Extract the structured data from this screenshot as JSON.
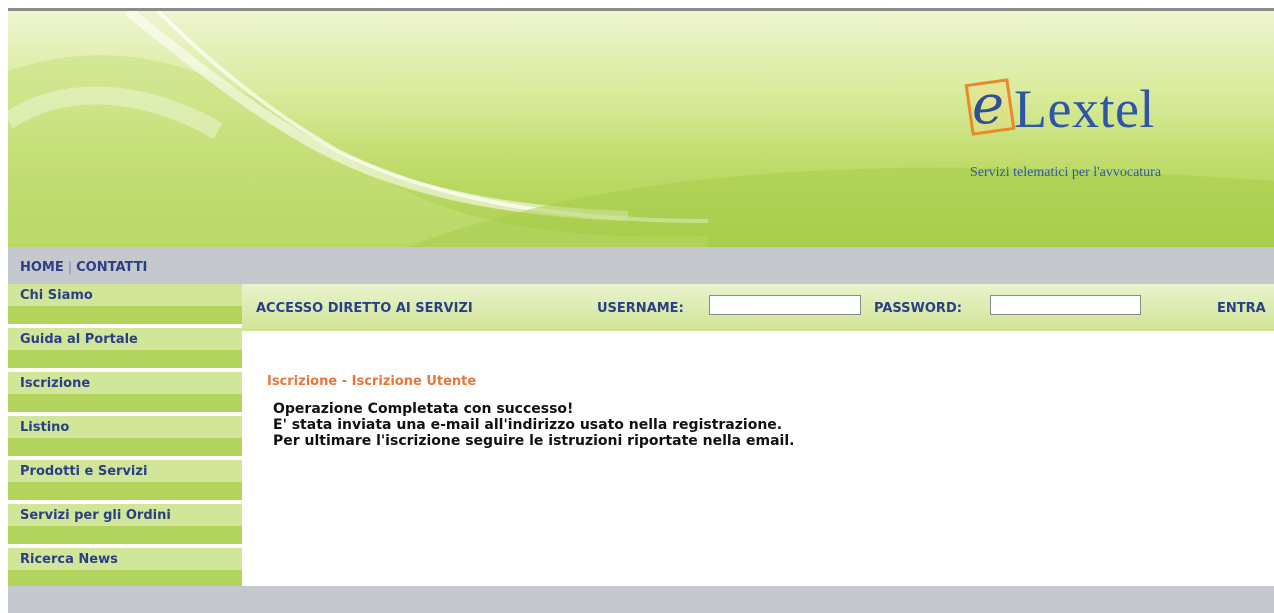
{
  "header": {
    "brand_name": "Lextel",
    "brand_initial": "e",
    "tagline": "Servizi telematici per l'avvocatura",
    "colors": {
      "banner_green": "#bfdc6a",
      "logo_blue": "#2f56a6",
      "logo_orange": "#e98a2a"
    }
  },
  "topnav": {
    "home": "HOME",
    "separator": "|",
    "contacts": "CONTATTI"
  },
  "sidebar": {
    "items": [
      {
        "label": "Chi Siamo"
      },
      {
        "label": "Guida al Portale"
      },
      {
        "label": "Iscrizione"
      },
      {
        "label": "Listino"
      },
      {
        "label": "Prodotti e Servizi"
      },
      {
        "label": "Servizi per gli Ordini"
      },
      {
        "label": "Ricerca News"
      }
    ]
  },
  "access": {
    "title": "ACCESSO DIRETTO AI SERVIZI",
    "username_label": "USERNAME:",
    "username_value": "",
    "password_label": "PASSWORD:",
    "password_value": "",
    "submit_label": "ENTRA"
  },
  "content": {
    "title": "Iscrizione - Iscrizione Utente",
    "lines": [
      "Operazione Completata con successo!",
      "E' stata inviata una e-mail all'indirizzo usato nella registrazione.",
      "Per ultimare l'iscrizione seguire le istruzioni riportate nella email."
    ]
  }
}
